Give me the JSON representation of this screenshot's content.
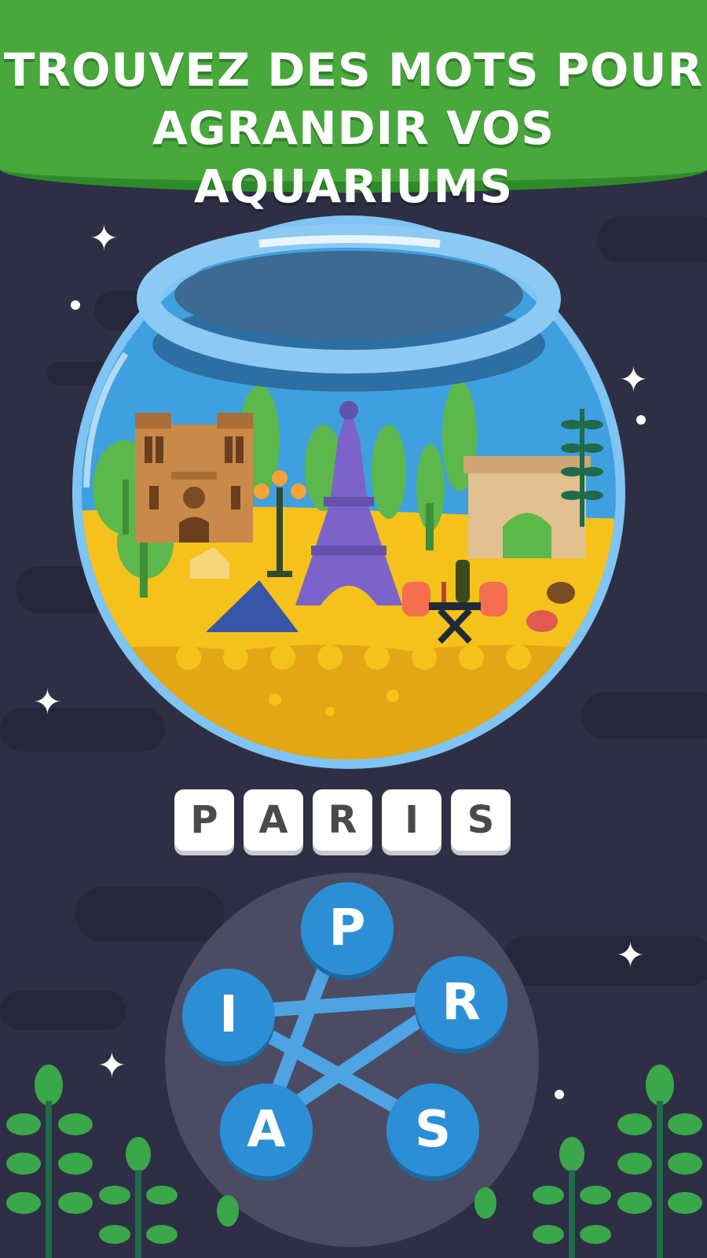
{
  "banner": {
    "title": "TROUVEZ DES MOTS POUR AGRANDIR VOS AQUARIUMS"
  },
  "aquarium": {
    "theme": "paris-landmarks-illustration"
  },
  "answer": {
    "letters": [
      "P",
      "A",
      "R",
      "I",
      "S"
    ]
  },
  "wheel": {
    "letters": {
      "p": "P",
      "r": "R",
      "i": "I",
      "a": "A",
      "s": "S"
    }
  },
  "colors": {
    "banner": "#48a83c",
    "background": "#2e2f45",
    "letter_circle": "#2c8fd6",
    "wheel": "#4b4c63",
    "tile": "#ffffff"
  }
}
